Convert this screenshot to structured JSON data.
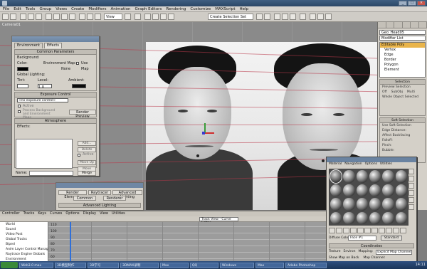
{
  "title_bar": {
    "title": ""
  },
  "menu": {
    "items": [
      "File",
      "Edit",
      "Tools",
      "Group",
      "Views",
      "Create",
      "Modifiers",
      "Animation",
      "Graph Editors",
      "Rendering",
      "Customize",
      "MAXScript",
      "Help"
    ]
  },
  "toolbar": {
    "view_dropdown": "View",
    "selection_set": "Create Selection Set"
  },
  "viewport": {
    "label": "Camera01"
  },
  "environment_window": {
    "title": "",
    "tabs": [
      "Environment",
      "Effects"
    ],
    "common_parameters": {
      "header": "Common Parameters",
      "background_label": "Background:",
      "color_label": "Color:",
      "env_map_label": "Environment Map:",
      "use_map_label": "Use Map",
      "none_label": "None",
      "global_lighting_label": "Global Lighting:",
      "tint_label": "Tint:",
      "level_label": "Level:",
      "level_value": "1.0",
      "ambient_label": "Ambient:"
    },
    "exposure_control": {
      "header": "Exposure Control",
      "dropdown": "<no exposure control>",
      "active_label": "Active",
      "process_bg_label": "Process Background and Environment Maps",
      "render_preview": "Render Preview"
    },
    "atmosphere": {
      "header": "Atmosphere",
      "effects_label": "Effects:",
      "add": "Add...",
      "delete": "Delete",
      "active": "Active",
      "move_up": "Move Up",
      "move_down": "Move Down",
      "name_label": "Name:",
      "merge": "Merge"
    }
  },
  "render_panel": {
    "title": "",
    "tabs": [
      "Render Elements",
      "Raytracer",
      "Advanced Lighting",
      "Common",
      "Renderer"
    ],
    "section": "Advanced Lighting"
  },
  "command_panel": {
    "object_name": "Geo_Head05",
    "modifier_list": "Modifier List",
    "stack": [
      "Editable Poly",
      "Vertex",
      "Edge",
      "Border",
      "Polygon",
      "Element"
    ],
    "sections": [
      "Selection",
      "Preview Selection",
      "Soft Selection"
    ],
    "options": [
      "Off",
      "SubObj",
      "Multi"
    ],
    "whole_object": "Whole Object Selected",
    "soft_rows": [
      "Use Soft Selection",
      "Edge Distance:",
      "Affect Backfacing",
      "Falloff:",
      "Pinch:",
      "Bubble:"
    ]
  },
  "material_editor": {
    "title": "",
    "menu": [
      "Material",
      "Navigation",
      "Options",
      "Utilities"
    ],
    "sphere_count": 24,
    "material_name": "Face #1",
    "material_type": "Standard",
    "shader_label": "Diffuse Color:",
    "coordinates_header": "Coordinates",
    "mapping": [
      "Texture",
      "Environ",
      "Mapping:",
      "Explicit Map Channel"
    ],
    "map_channel_label": "Map Channel:",
    "show_map_label": "Show Map on Back"
  },
  "track_view": {
    "menu": [
      "Controller",
      "Tracks",
      "Keys",
      "Curves",
      "Options",
      "Display",
      "View",
      "Utilities"
    ],
    "tree": [
      "World",
      "Sound",
      "Video Post",
      "Global Tracks",
      "Biped",
      "Anim Layer Control Manager",
      "Raytrace Engine Globals",
      "Environment"
    ],
    "y_values": [
      "110",
      "100",
      "90",
      "80",
      "70",
      "60"
    ],
    "title_field": "Track View - Curve Editor"
  },
  "taskbar": {
    "tasks": [
      "Web3.0 max",
      "3D模型制作",
      "3D学习",
      "3DMAX录制",
      "Max",
      "QQ",
      "Windows",
      "Max",
      "Adobe Photoshop"
    ],
    "clock": "14:11"
  }
}
